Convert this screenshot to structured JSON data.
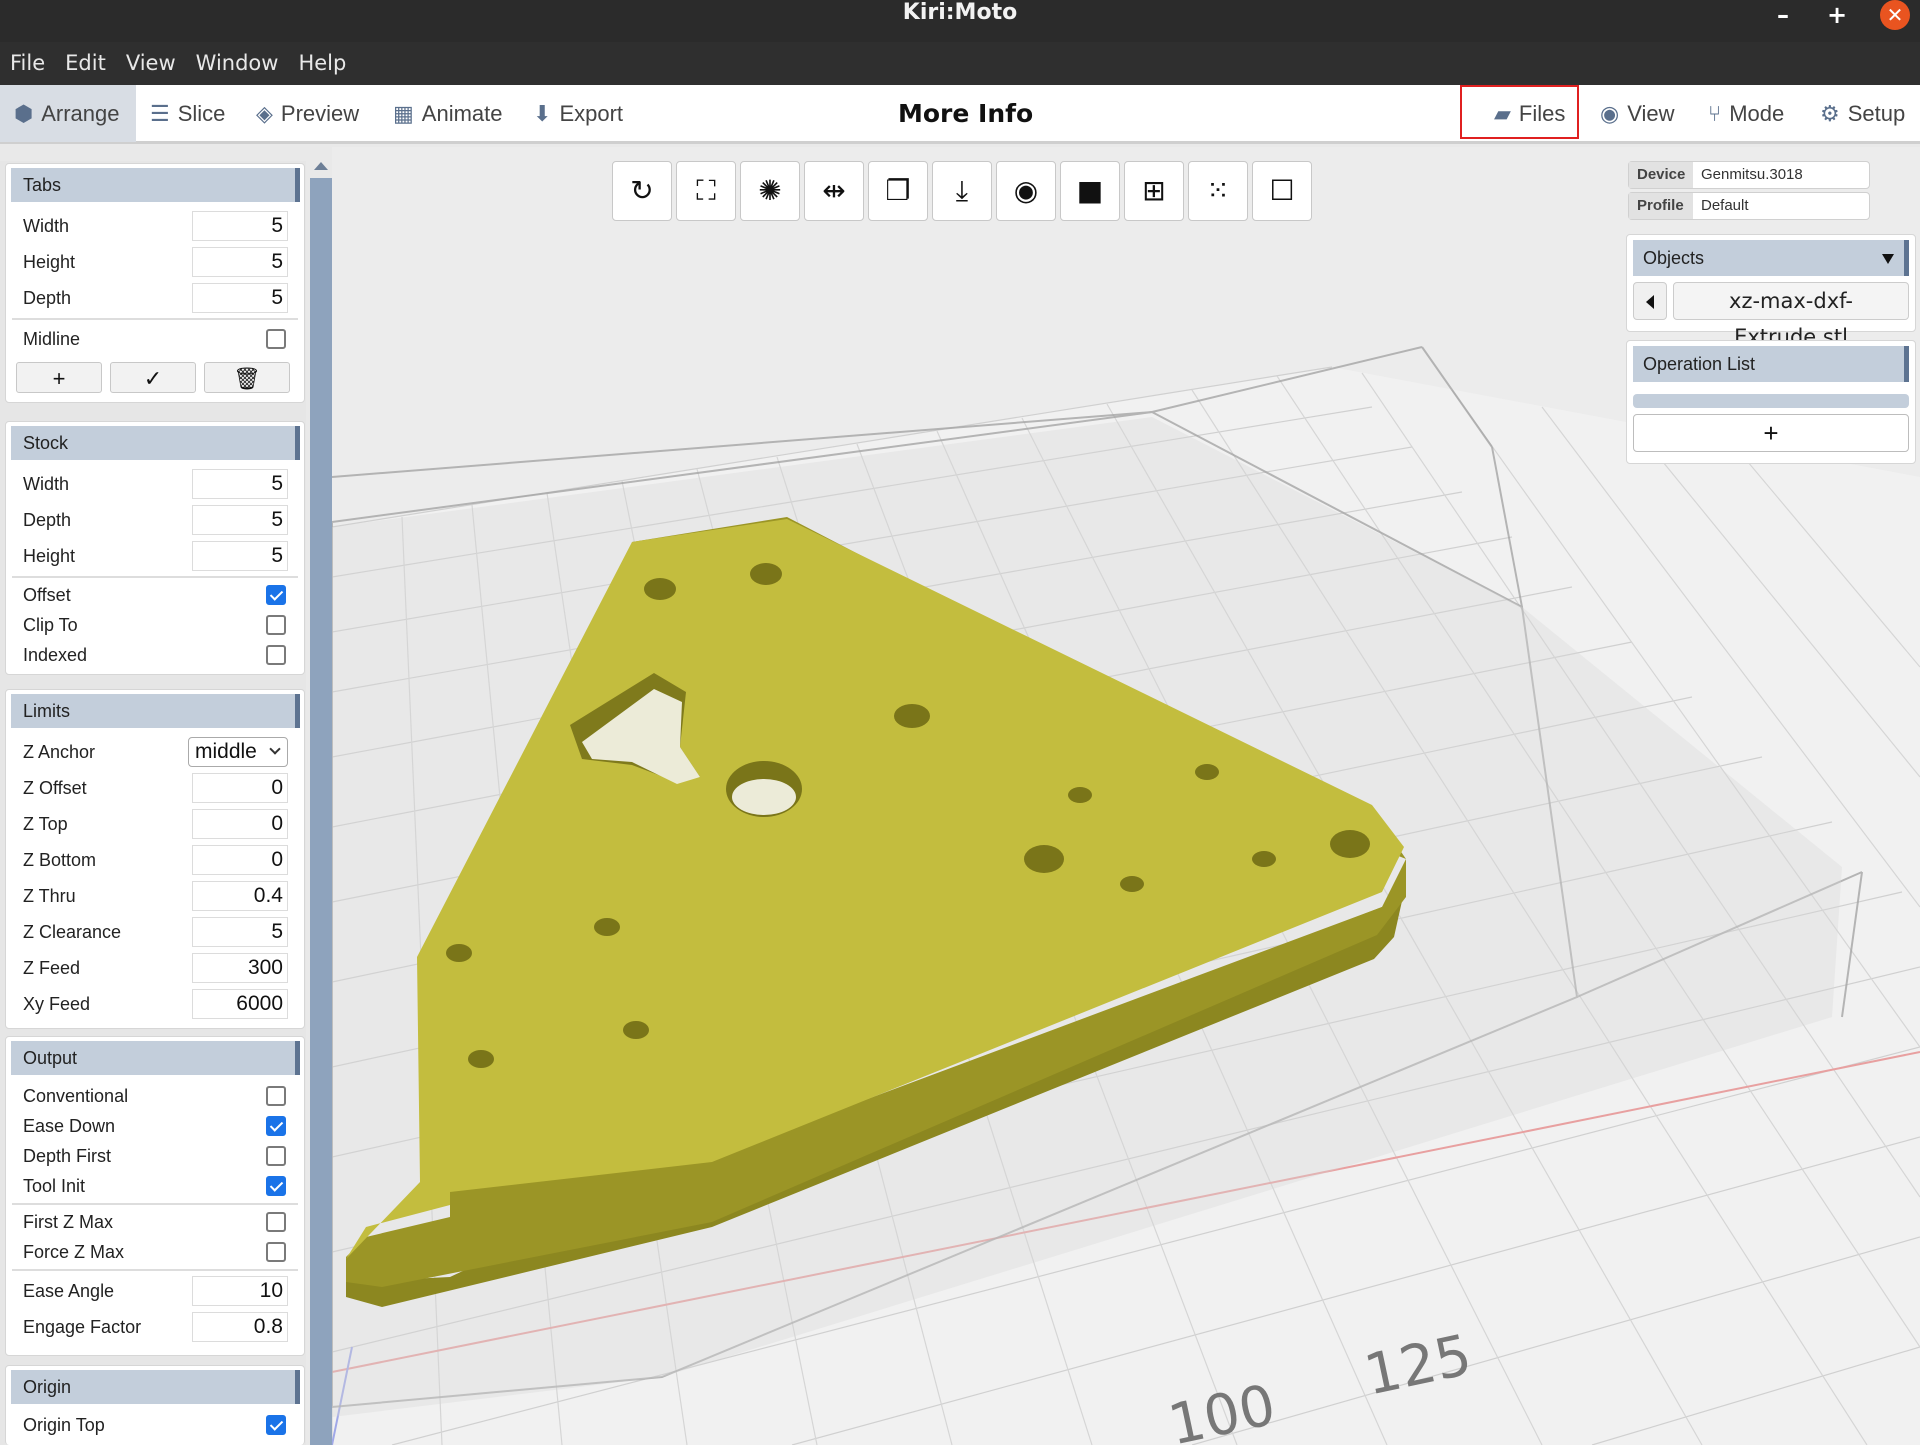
{
  "window": {
    "title": "Kiri:Moto",
    "minimize": "–",
    "maximize": "+",
    "close": "✕"
  },
  "menu": [
    "File",
    "Edit",
    "View",
    "Window",
    "Help"
  ],
  "toolbar": {
    "arrange": "Arrange",
    "slice": "Slice",
    "preview": "Preview",
    "animate": "Animate",
    "export": "Export",
    "more_info": "More Info",
    "files": "Files",
    "view": "View",
    "mode": "Mode",
    "setup": "Setup"
  },
  "tabs_group": {
    "title": "Tabs",
    "width_label": "Width",
    "width": "5",
    "height_label": "Height",
    "height": "5",
    "depth_label": "Depth",
    "depth": "5",
    "midline_label": "Midline",
    "midline": false,
    "add": "+",
    "accept": "✓",
    "delete": "🗑"
  },
  "stock": {
    "title": "Stock",
    "width_label": "Width",
    "width": "5",
    "depth_label": "Depth",
    "depth": "5",
    "height_label": "Height",
    "height": "5",
    "offset_label": "Offset",
    "offset": true,
    "clip_label": "Clip To",
    "clip": false,
    "indexed_label": "Indexed",
    "indexed": false
  },
  "limits": {
    "title": "Limits",
    "z_anchor_label": "Z Anchor",
    "z_anchor": "middle",
    "z_offset_label": "Z Offset",
    "z_offset": "0",
    "z_top_label": "Z Top",
    "z_top": "0",
    "z_bottom_label": "Z Bottom",
    "z_bottom": "0",
    "z_thru_label": "Z Thru",
    "z_thru": "0.4",
    "z_clearance_label": "Z Clearance",
    "z_clearance": "5",
    "z_feed_label": "Z Feed",
    "z_feed": "300",
    "xy_feed_label": "Xy Feed",
    "xy_feed": "6000"
  },
  "output": {
    "title": "Output",
    "conventional_label": "Conventional",
    "conventional": false,
    "ease_down_label": "Ease Down",
    "ease_down": true,
    "depth_first_label": "Depth First",
    "depth_first": false,
    "tool_init_label": "Tool Init",
    "tool_init": true,
    "first_z_max_label": "First Z Max",
    "first_z_max": false,
    "force_z_max_label": "Force Z Max",
    "force_z_max": false,
    "ease_angle_label": "Ease Angle",
    "ease_angle": "10",
    "engage_factor_label": "Engage Factor",
    "engage_factor": "0.8"
  },
  "origin": {
    "title": "Origin",
    "origin_top_label": "Origin Top",
    "origin_top": true
  },
  "device": {
    "device_key": "Device",
    "device": "Genmitsu.3018",
    "profile_key": "Profile",
    "profile": "Default"
  },
  "objects": {
    "title": "Objects",
    "selected": "xz-max-dxf-Extrude.stl"
  },
  "operations": {
    "title": "Operation List",
    "add": "+"
  },
  "viewport": {
    "axis_labels": [
      "100",
      "125"
    ]
  },
  "colors": {
    "part": "#c3bd3e",
    "accent": "#5d7391",
    "highlight": "#e02020"
  }
}
